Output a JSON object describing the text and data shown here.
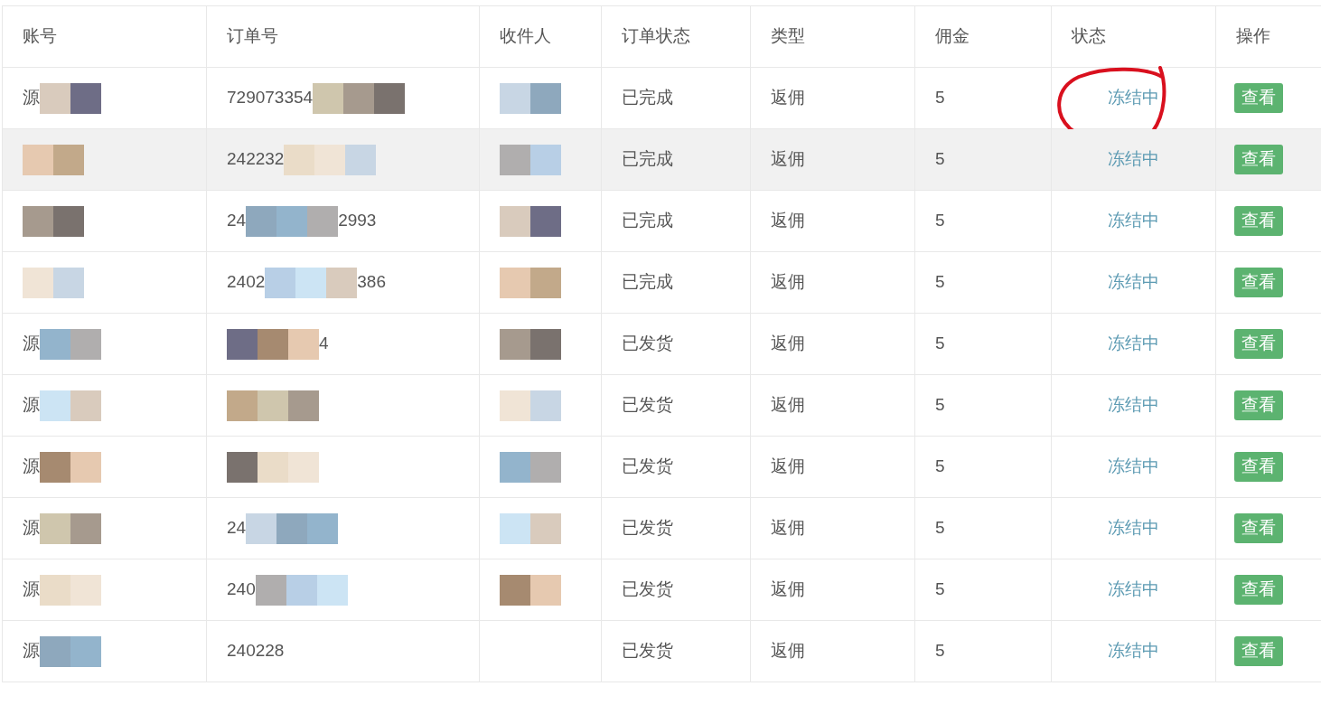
{
  "table": {
    "columns": [
      "账号",
      "订单号",
      "收件人",
      "订单状态",
      "类型",
      "佣金",
      "状态",
      "操作"
    ],
    "rows": [
      {
        "account": {
          "text": "源",
          "masked": true
        },
        "order_no": {
          "text": "729073354",
          "masked": true
        },
        "recipient": {
          "masked": true
        },
        "order_status": "已完成",
        "type": "返佣",
        "commission": "5",
        "status": "冻结中",
        "action": "查看",
        "highlighted": false,
        "circled": true
      },
      {
        "account": {
          "masked": true
        },
        "order_no": {
          "text": "242232",
          "masked": true
        },
        "recipient": {
          "masked": true
        },
        "order_status": "已完成",
        "type": "返佣",
        "commission": "5",
        "status": "冻结中",
        "action": "查看",
        "highlighted": true,
        "circled": false
      },
      {
        "account": {
          "masked": true
        },
        "order_no": {
          "text": "24",
          "masked": true,
          "tail": "2993"
        },
        "recipient": {
          "masked": true
        },
        "order_status": "已完成",
        "type": "返佣",
        "commission": "5",
        "status": "冻结中",
        "action": "查看",
        "highlighted": false,
        "circled": false
      },
      {
        "account": {
          "masked": true
        },
        "order_no": {
          "text": "2402",
          "masked": true,
          "tail": "386"
        },
        "recipient": {
          "masked": true
        },
        "order_status": "已完成",
        "type": "返佣",
        "commission": "5",
        "status": "冻结中",
        "action": "查看",
        "highlighted": false,
        "circled": false
      },
      {
        "account": {
          "text": "源",
          "masked": true
        },
        "order_no": {
          "masked": true,
          "tail": "4"
        },
        "recipient": {
          "masked": true
        },
        "order_status": "已发货",
        "type": "返佣",
        "commission": "5",
        "status": "冻结中",
        "action": "查看",
        "highlighted": false,
        "circled": false
      },
      {
        "account": {
          "text": "源",
          "masked": true
        },
        "order_no": {
          "masked": true
        },
        "recipient": {
          "masked": true
        },
        "order_status": "已发货",
        "type": "返佣",
        "commission": "5",
        "status": "冻结中",
        "action": "查看",
        "highlighted": false,
        "circled": false
      },
      {
        "account": {
          "text": "源",
          "masked": true
        },
        "order_no": {
          "masked": true
        },
        "recipient": {
          "masked": true
        },
        "order_status": "已发货",
        "type": "返佣",
        "commission": "5",
        "status": "冻结中",
        "action": "查看",
        "highlighted": false,
        "circled": false
      },
      {
        "account": {
          "text": "源",
          "masked": true
        },
        "order_no": {
          "text": "24",
          "masked": true
        },
        "recipient": {
          "masked": true
        },
        "order_status": "已发货",
        "type": "返佣",
        "commission": "5",
        "status": "冻结中",
        "action": "查看",
        "highlighted": false,
        "circled": false
      },
      {
        "account": {
          "text": "源",
          "masked": true
        },
        "order_no": {
          "text": "240",
          "masked": true
        },
        "recipient": {
          "masked": true
        },
        "order_status": "已发货",
        "type": "返佣",
        "commission": "5",
        "status": "冻结中",
        "action": "查看",
        "highlighted": false,
        "circled": false
      },
      {
        "account": {
          "text": "源",
          "masked": true
        },
        "order_no": {
          "text": "240228",
          "masked": false
        },
        "recipient": {
          "masked": false
        },
        "order_status": "已发货",
        "type": "返佣",
        "commission": "5",
        "status": "冻结中",
        "action": "查看",
        "highlighted": false,
        "circled": false
      }
    ]
  }
}
